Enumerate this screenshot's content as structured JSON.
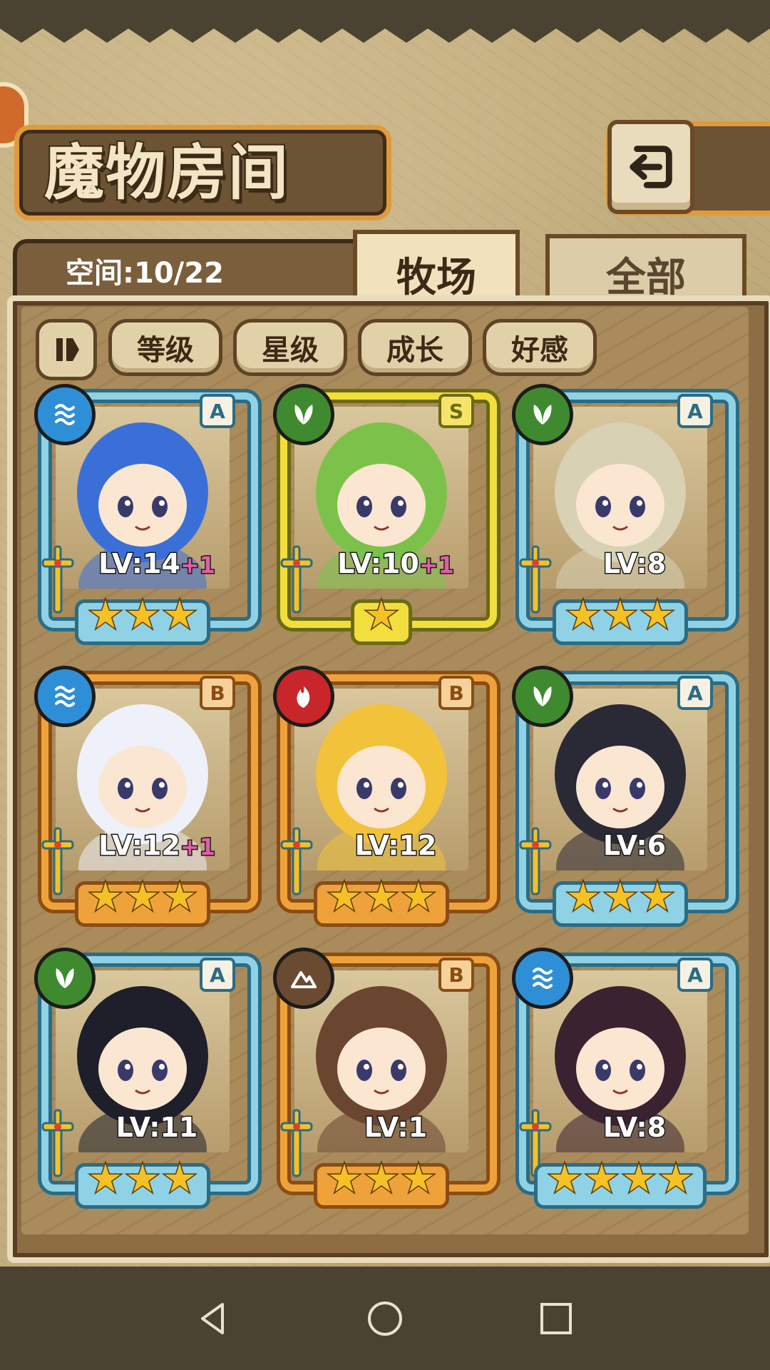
{
  "title": "魔物房间",
  "space": "空间:10/22",
  "tabs": {
    "active": "牧场",
    "inactive": "全部"
  },
  "sort": {
    "toggle_icon": "pause-icon",
    "buttons": [
      "等级",
      "星级",
      "成长",
      "好感"
    ]
  },
  "monsters": [
    {
      "element": "water",
      "rank": "A",
      "level": "LV:14",
      "bonus": "+1",
      "stars": 3,
      "hair": "#3b6fd8",
      "frame": "A"
    },
    {
      "element": "grass",
      "rank": "S",
      "level": "LV:10",
      "bonus": "+1",
      "stars": 1,
      "hair": "#7cc24a",
      "frame": "S"
    },
    {
      "element": "grass",
      "rank": "A",
      "level": "LV:8",
      "bonus": "",
      "stars": 3,
      "hair": "#d8d1b4",
      "frame": "A"
    },
    {
      "element": "water",
      "rank": "B",
      "level": "LV:12",
      "bonus": "+1",
      "stars": 3,
      "hair": "#eef0fa",
      "frame": "B"
    },
    {
      "element": "fire",
      "rank": "B",
      "level": "LV:12",
      "bonus": "",
      "stars": 3,
      "hair": "#f2c23a",
      "frame": "B"
    },
    {
      "element": "grass",
      "rank": "A",
      "level": "LV:6",
      "bonus": "",
      "stars": 3,
      "hair": "#2a2936",
      "frame": "A"
    },
    {
      "element": "grass",
      "rank": "A",
      "level": "LV:11",
      "bonus": "",
      "stars": 3,
      "hair": "#1e1f2a",
      "frame": "A"
    },
    {
      "element": "earth",
      "rank": "B",
      "level": "LV:1",
      "bonus": "",
      "stars": 3,
      "hair": "#6a4530",
      "frame": "B"
    },
    {
      "element": "water",
      "rank": "A",
      "level": "LV:8",
      "bonus": "",
      "stars": 4,
      "hair": "#3a2230",
      "frame": "A"
    }
  ],
  "element_colors": {
    "water": "#2f8fd6",
    "grass": "#3f8a2e",
    "fire": "#c8262a",
    "earth": "#6b4a32"
  },
  "nav": {
    "back": "triangle-back-icon",
    "home": "circle-home-icon",
    "recent": "square-recent-icon"
  }
}
